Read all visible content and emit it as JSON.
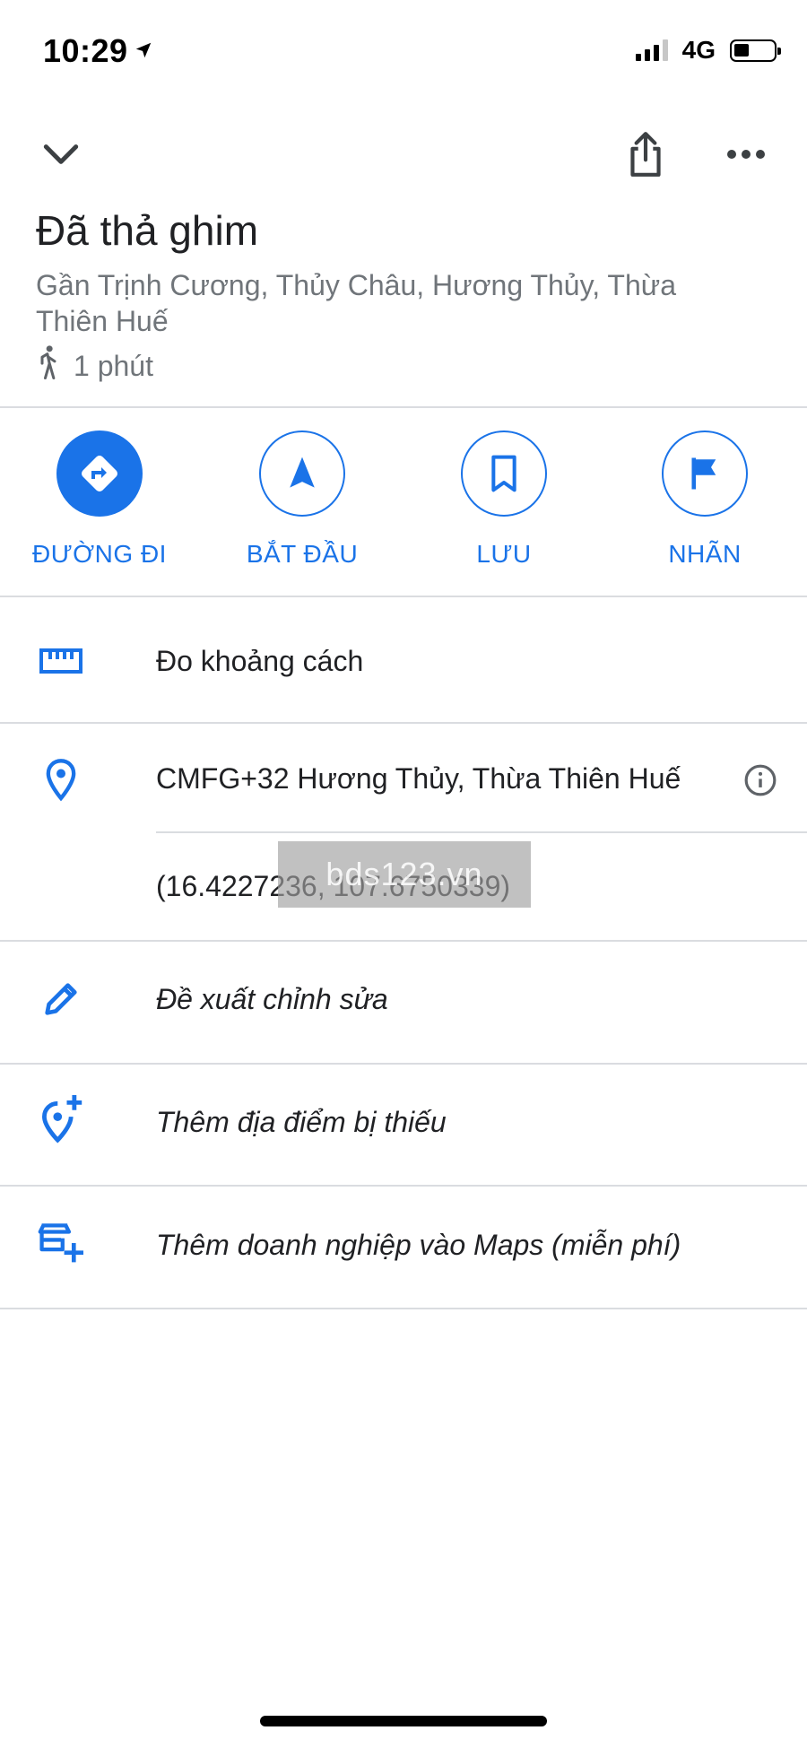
{
  "status_bar": {
    "time": "10:29",
    "network": "4G",
    "location_arrow_icon": "location-arrow-icon",
    "battery_level": 0.4
  },
  "top_bar": {
    "back_icon": "chevron-down-icon",
    "share_icon": "share-icon",
    "more_icon": "more-horizontal-icon"
  },
  "place": {
    "title": "Đã thả ghim",
    "address": "Gần Trịnh Cương, Thủy Châu, Hương Thủy, Thừa Thiên Huế",
    "walk_time": "1 phút",
    "walk_icon": "walking-person-icon"
  },
  "actions": [
    {
      "label": "ĐƯỜNG ĐI",
      "icon": "directions-icon"
    },
    {
      "label": "BẮT ĐẦU",
      "icon": "navigation-arrow-icon"
    },
    {
      "label": "LƯU",
      "icon": "bookmark-icon"
    },
    {
      "label": "NHÃN",
      "icon": "flag-icon"
    }
  ],
  "rows": {
    "measure": {
      "label": "Đo khoảng cách",
      "icon": "ruler-icon"
    },
    "plus_code": {
      "label": "CMFG+32 Hương Thủy, Thừa Thiên Huế",
      "icon": "location-pin-icon",
      "info_icon": "info-icon"
    },
    "coordinates": {
      "label": "(16.4227236, 107.6750339)"
    },
    "suggest_edit": {
      "label": "Đề xuất chỉnh sửa",
      "icon": "pencil-icon"
    },
    "add_place": {
      "label": "Thêm địa điểm bị thiếu",
      "icon": "add-location-icon"
    },
    "add_business": {
      "label": "Thêm doanh nghiệp vào Maps (miễn phí)",
      "icon": "add-business-icon"
    }
  },
  "watermark": "bds123.vn",
  "colors": {
    "accent": "#1a73e8",
    "text_primary": "#202124",
    "text_secondary": "#70757a",
    "divider": "#dadce0"
  }
}
